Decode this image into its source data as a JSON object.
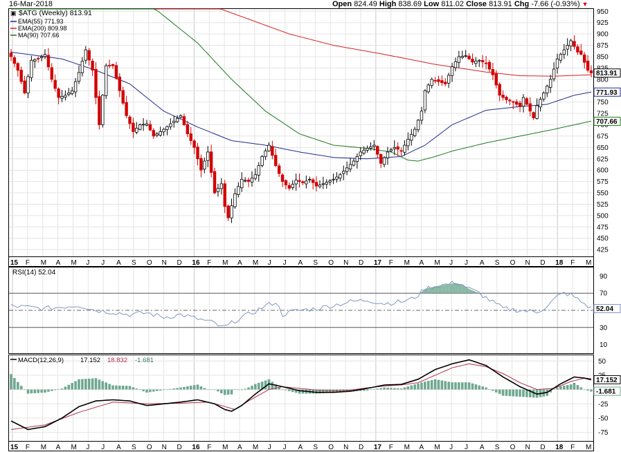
{
  "header": {
    "date": "16-Mar-2018",
    "open_label": "Open",
    "open": "824.49",
    "high_label": "High",
    "high": "838.69",
    "low_label": "Low",
    "low": "811.02",
    "close_label": "Close",
    "close": "813.91",
    "chg_label": "Chg",
    "chg": "-7.66 (-0.93%)",
    "chg_arrow": "▼"
  },
  "legend": {
    "symbol": "$ATG (Weekly) 813.91",
    "ema55": "EMA(55) 771.93",
    "ema200": "EMA(200) 809.98",
    "ma90": "MA(90) 707.66"
  },
  "rsi_label": "RSI(14) 52.04",
  "macd_label": {
    "name": "MACD(12,26,9)",
    "macd": "17.152",
    "signal": "18.832",
    "hist": "-1.681"
  },
  "colors": {
    "up": "#000000",
    "down": "#d40000",
    "ema55": "#1f2a8c",
    "ema200": "#d62020",
    "ma90": "#1c7a1c",
    "rsi": "#8096c4",
    "macd": "#000000",
    "signal": "#b0304a",
    "hist": "#6fa890",
    "grid": "#e4e4e4",
    "value_box_bg": "#ffffff"
  },
  "x_axis": {
    "labels": [
      "15",
      "F",
      "M",
      "A",
      "M",
      "J",
      "J",
      "A",
      "S",
      "O",
      "N",
      "D",
      "16",
      "F",
      "M",
      "A",
      "M",
      "J",
      "J",
      "A",
      "S",
      "O",
      "N",
      "D",
      "17",
      "F",
      "M",
      "A",
      "M",
      "J",
      "J",
      "A",
      "S",
      "O",
      "N",
      "D",
      "18",
      "F",
      "M"
    ],
    "bold_labels": [
      "15",
      "16",
      "17",
      "18"
    ]
  },
  "chart_data": [
    {
      "type": "candlestick",
      "title": "$ATG (Weekly)",
      "period": "weekly",
      "x_range": [
        "Jan 2015",
        "Mar 2018"
      ],
      "ylim": [
        410,
        955
      ],
      "y_ticks": [
        425,
        450,
        475,
        500,
        525,
        550,
        575,
        600,
        625,
        650,
        675,
        700,
        725,
        750,
        775,
        800,
        825,
        850,
        875,
        900,
        925,
        950
      ],
      "y_tick_labels": [
        "425",
        "450",
        "475",
        "500",
        "525",
        "550",
        "575",
        "600",
        "625",
        "650",
        "675",
        "700",
        "725",
        "750",
        "775",
        "800",
        "825",
        "850",
        "875",
        "900",
        "925",
        "950"
      ],
      "last_values": {
        "close": "813.91",
        "ema55": "771.93",
        "ma90": "707.66"
      },
      "close_anchors": [
        [
          0,
          850
        ],
        [
          2,
          820
        ],
        [
          4,
          770
        ],
        [
          6,
          842
        ],
        [
          8,
          845
        ],
        [
          10,
          855
        ],
        [
          12,
          800
        ],
        [
          14,
          760
        ],
        [
          16,
          765
        ],
        [
          18,
          775
        ],
        [
          20,
          815
        ],
        [
          22,
          865
        ],
        [
          24,
          820
        ],
        [
          26,
          700
        ],
        [
          28,
          830
        ],
        [
          30,
          830
        ],
        [
          34,
          720
        ],
        [
          36,
          685
        ],
        [
          38,
          700
        ],
        [
          40,
          702
        ],
        [
          42,
          675
        ],
        [
          45,
          690
        ],
        [
          50,
          720
        ],
        [
          52,
          680
        ],
        [
          54,
          650
        ],
        [
          56,
          600
        ],
        [
          58,
          640
        ],
        [
          60,
          550
        ],
        [
          62,
          570
        ],
        [
          63,
          520
        ],
        [
          64,
          495
        ],
        [
          66,
          548
        ],
        [
          68,
          580
        ],
        [
          70,
          575
        ],
        [
          72,
          590
        ],
        [
          74,
          630
        ],
        [
          76,
          655
        ],
        [
          78,
          610
        ],
        [
          80,
          575
        ],
        [
          82,
          560
        ],
        [
          84,
          578
        ],
        [
          86,
          572
        ],
        [
          88,
          580
        ],
        [
          90,
          565
        ],
        [
          92,
          570
        ],
        [
          95,
          580
        ],
        [
          97,
          590
        ],
        [
          99,
          605
        ],
        [
          101,
          620
        ],
        [
          103,
          640
        ],
        [
          105,
          648
        ],
        [
          107,
          655
        ],
        [
          109,
          615
        ],
        [
          111,
          640
        ],
        [
          113,
          650
        ],
        [
          115,
          642
        ],
        [
          117,
          668
        ],
        [
          119,
          690
        ],
        [
          121,
          730
        ],
        [
          122,
          775
        ],
        [
          124,
          800
        ],
        [
          126,
          795
        ],
        [
          128,
          790
        ],
        [
          130,
          828
        ],
        [
          132,
          850
        ],
        [
          134,
          852
        ],
        [
          136,
          838
        ],
        [
          138,
          842
        ],
        [
          140,
          835
        ],
        [
          142,
          810
        ],
        [
          144,
          765
        ],
        [
          146,
          755
        ],
        [
          148,
          750
        ],
        [
          150,
          740
        ],
        [
          151,
          760
        ],
        [
          153,
          730
        ],
        [
          154,
          715
        ],
        [
          155,
          742
        ],
        [
          157,
          770
        ],
        [
          159,
          800
        ],
        [
          161,
          845
        ],
        [
          163,
          865
        ],
        [
          165,
          885
        ],
        [
          167,
          860
        ],
        [
          168,
          855
        ],
        [
          170,
          820
        ],
        [
          171,
          814
        ]
      ],
      "ema200_anchors": [
        [
          0,
          1100
        ],
        [
          35,
          1030
        ],
        [
          60,
          960
        ],
        [
          82,
          900
        ],
        [
          95,
          875
        ],
        [
          110,
          855
        ],
        [
          125,
          833
        ],
        [
          140,
          816
        ],
        [
          150,
          808
        ],
        [
          160,
          807
        ],
        [
          171,
          810
        ]
      ],
      "ema55_anchors": [
        [
          0,
          860
        ],
        [
          15,
          845
        ],
        [
          25,
          820
        ],
        [
          35,
          790
        ],
        [
          45,
          730
        ],
        [
          55,
          695
        ],
        [
          65,
          665
        ],
        [
          75,
          655
        ],
        [
          85,
          640
        ],
        [
          95,
          628
        ],
        [
          105,
          625
        ],
        [
          115,
          630
        ],
        [
          122,
          655
        ],
        [
          130,
          700
        ],
        [
          140,
          732
        ],
        [
          150,
          740
        ],
        [
          158,
          745
        ],
        [
          162,
          755
        ],
        [
          166,
          765
        ],
        [
          171,
          772
        ]
      ],
      "ma90_anchors": [
        [
          0,
          1100
        ],
        [
          40,
          970
        ],
        [
          55,
          880
        ],
        [
          65,
          800
        ],
        [
          75,
          730
        ],
        [
          85,
          680
        ],
        [
          95,
          655
        ],
        [
          105,
          648
        ],
        [
          112,
          640
        ],
        [
          117,
          622
        ],
        [
          120,
          620
        ],
        [
          125,
          630
        ],
        [
          130,
          642
        ],
        [
          140,
          660
        ],
        [
          150,
          675
        ],
        [
          160,
          690
        ],
        [
          171,
          708
        ]
      ]
    },
    {
      "type": "line",
      "title": "RSI(14) 52.04",
      "ylim": [
        0,
        100
      ],
      "y_ticks": [
        10,
        30,
        50,
        70,
        90
      ],
      "y_tick_labels": [
        "10",
        "30",
        "50",
        "70",
        "90"
      ],
      "reference_levels": [
        30,
        50,
        70
      ],
      "shaded_above": 70,
      "last_value": "52.04",
      "anchors": [
        [
          0,
          55
        ],
        [
          10,
          52
        ],
        [
          20,
          56
        ],
        [
          25,
          50
        ],
        [
          30,
          48
        ],
        [
          35,
          45
        ],
        [
          40,
          47
        ],
        [
          45,
          42
        ],
        [
          50,
          45
        ],
        [
          55,
          40
        ],
        [
          60,
          35
        ],
        [
          62,
          30
        ],
        [
          64,
          32
        ],
        [
          66,
          38
        ],
        [
          70,
          45
        ],
        [
          75,
          55
        ],
        [
          78,
          60
        ],
        [
          80,
          45
        ],
        [
          82,
          48
        ],
        [
          85,
          50
        ],
        [
          90,
          52
        ],
        [
          95,
          56
        ],
        [
          100,
          60
        ],
        [
          105,
          62
        ],
        [
          110,
          58
        ],
        [
          115,
          60
        ],
        [
          118,
          63
        ],
        [
          120,
          68
        ],
        [
          122,
          75
        ],
        [
          125,
          78
        ],
        [
          128,
          80
        ],
        [
          131,
          82
        ],
        [
          133,
          80
        ],
        [
          135,
          75
        ],
        [
          138,
          70
        ],
        [
          141,
          62
        ],
        [
          145,
          52
        ],
        [
          150,
          50
        ],
        [
          155,
          48
        ],
        [
          158,
          55
        ],
        [
          161,
          66
        ],
        [
          163,
          70
        ],
        [
          165,
          68
        ],
        [
          168,
          60
        ],
        [
          170,
          55
        ],
        [
          171,
          52
        ]
      ]
    },
    {
      "type": "line",
      "title": "MACD(12,26,9)",
      "ylim": [
        -90,
        60
      ],
      "y_ticks": [
        -75,
        -50,
        -25,
        0,
        25,
        50
      ],
      "y_tick_labels": [
        "-75",
        "-50",
        "-25",
        "0",
        "25",
        "50"
      ],
      "last_values": {
        "macd": "17.152",
        "signal": "18.832",
        "histogram": "-1.681"
      },
      "macd_anchors": [
        [
          0,
          -55
        ],
        [
          5,
          -70
        ],
        [
          10,
          -65
        ],
        [
          15,
          -50
        ],
        [
          20,
          -30
        ],
        [
          25,
          -20
        ],
        [
          30,
          -18
        ],
        [
          35,
          -20
        ],
        [
          40,
          -28
        ],
        [
          45,
          -25
        ],
        [
          50,
          -22
        ],
        [
          55,
          -18
        ],
        [
          60,
          -25
        ],
        [
          63,
          -35
        ],
        [
          65,
          -38
        ],
        [
          68,
          -28
        ],
        [
          72,
          -8
        ],
        [
          76,
          10
        ],
        [
          80,
          5
        ],
        [
          85,
          -2
        ],
        [
          90,
          -5
        ],
        [
          95,
          -5
        ],
        [
          100,
          -3
        ],
        [
          105,
          2
        ],
        [
          110,
          8
        ],
        [
          115,
          9
        ],
        [
          120,
          18
        ],
        [
          125,
          35
        ],
        [
          130,
          45
        ],
        [
          135,
          52
        ],
        [
          140,
          42
        ],
        [
          145,
          22
        ],
        [
          150,
          5
        ],
        [
          155,
          -8
        ],
        [
          158,
          -5
        ],
        [
          162,
          10
        ],
        [
          166,
          22
        ],
        [
          169,
          20
        ],
        [
          171,
          17
        ]
      ],
      "signal_anchors": [
        [
          0,
          -70
        ],
        [
          10,
          -62
        ],
        [
          20,
          -40
        ],
        [
          30,
          -22
        ],
        [
          40,
          -25
        ],
        [
          50,
          -24
        ],
        [
          58,
          -22
        ],
        [
          62,
          -28
        ],
        [
          66,
          -35
        ],
        [
          70,
          -20
        ],
        [
          76,
          0
        ],
        [
          80,
          5
        ],
        [
          85,
          2
        ],
        [
          90,
          -1
        ],
        [
          95,
          -2
        ],
        [
          100,
          -1
        ],
        [
          105,
          3
        ],
        [
          110,
          6
        ],
        [
          115,
          8
        ],
        [
          120,
          12
        ],
        [
          125,
          25
        ],
        [
          130,
          38
        ],
        [
          135,
          45
        ],
        [
          140,
          40
        ],
        [
          145,
          28
        ],
        [
          150,
          12
        ],
        [
          155,
          0
        ],
        [
          160,
          2
        ],
        [
          165,
          14
        ],
        [
          169,
          20
        ],
        [
          171,
          19
        ]
      ]
    }
  ]
}
